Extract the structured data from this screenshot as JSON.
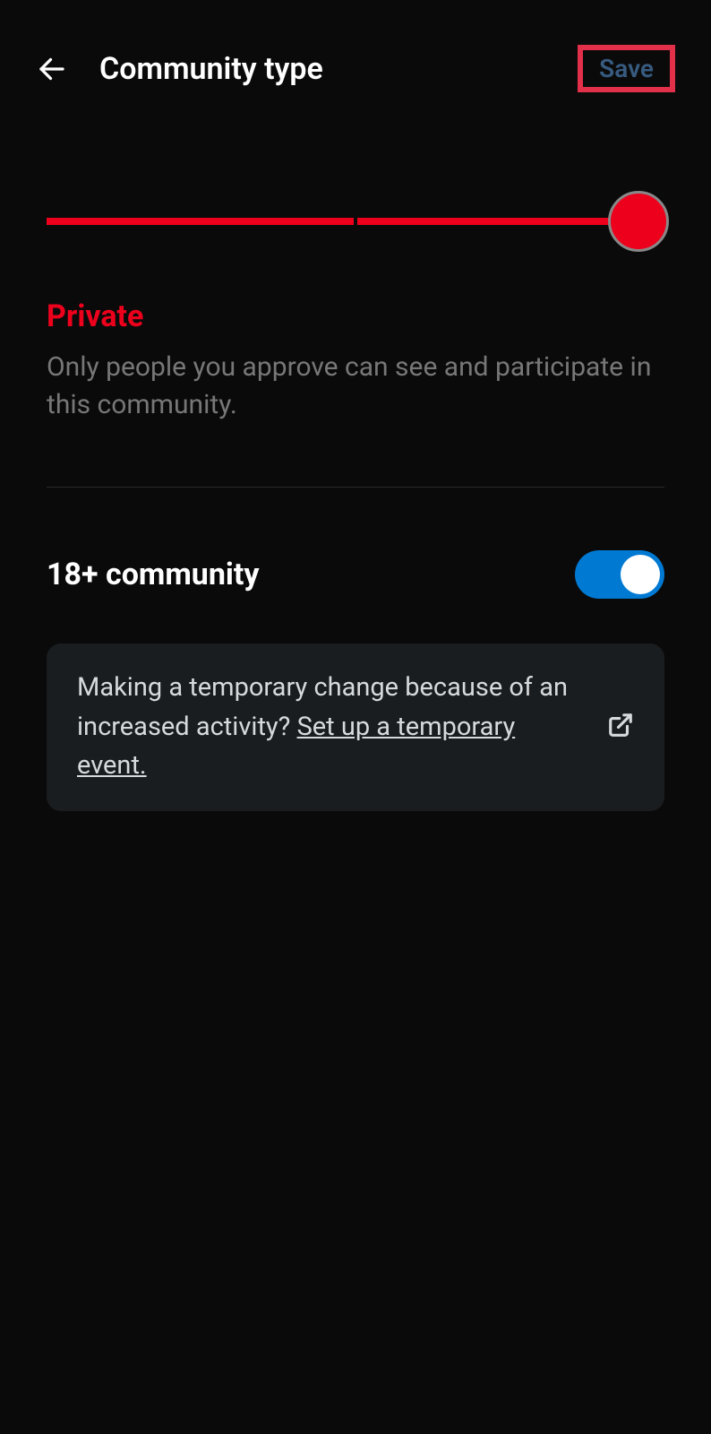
{
  "header": {
    "title": "Community type",
    "save_label": "Save"
  },
  "selection": {
    "title": "Private",
    "description": "Only people you approve can see and participate in this community."
  },
  "toggle": {
    "label": "18+ community",
    "enabled": true
  },
  "info": {
    "text": "Making a temporary change because of an increased activity? ",
    "link_text": "Set up a temporary event."
  }
}
